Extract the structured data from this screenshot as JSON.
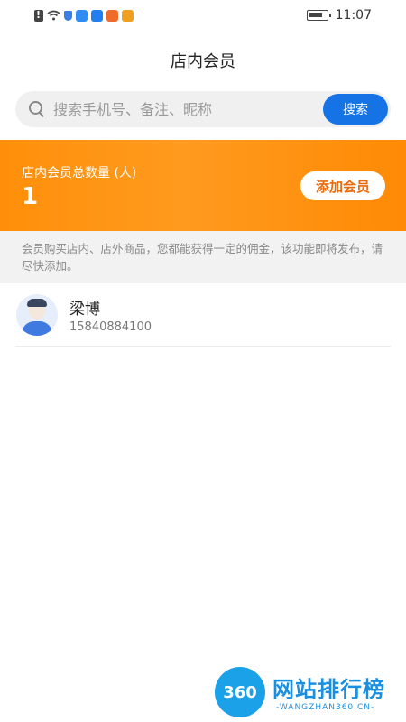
{
  "status_bar": {
    "time": "11:07",
    "icons": [
      "alert-icon",
      "wifi-icon",
      "shield-icon",
      "app-icon-1",
      "app-icon-2",
      "app-icon-3",
      "app-icon-4",
      "battery-icon"
    ]
  },
  "header": {
    "title": "店内会员"
  },
  "search": {
    "placeholder": "搜索手机号、备注、昵称",
    "button_label": "搜索"
  },
  "banner": {
    "label": "店内会员总数量 (人)",
    "count": "1",
    "add_button_label": "添加会员"
  },
  "notice": {
    "text": "会员购买店内、店外商品，您都能获得一定的佣金，该功能即将发布，请尽快添加。"
  },
  "members": [
    {
      "name": "梁博",
      "phone": "15840884100"
    }
  ],
  "watermark": {
    "logo": "360",
    "title": "网站排行榜",
    "subtitle": "-WANGZHAN360.CN-"
  },
  "colors": {
    "accent_blue": "#1673e6",
    "banner_orange": "#ff8f0a",
    "add_button_text": "#e86a0c"
  }
}
